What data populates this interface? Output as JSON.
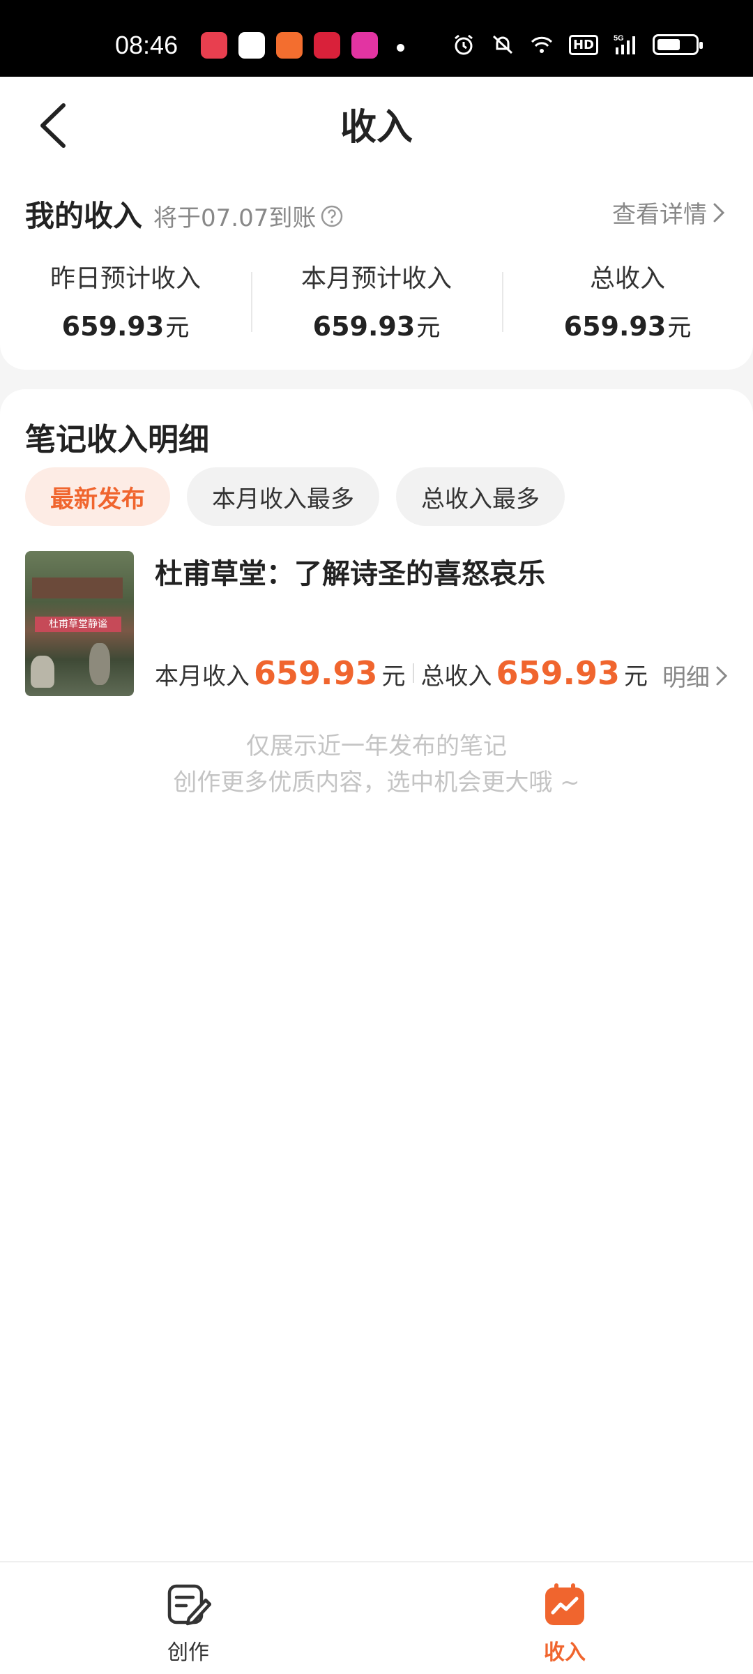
{
  "status_bar": {
    "time": "08:46",
    "apps": [
      "#e83f4f",
      "#ffffff",
      "#f36e2f",
      "#d9213a",
      "#e234a2"
    ],
    "hd": "HD",
    "net": "5G"
  },
  "header": {
    "title": "收入"
  },
  "earnings": {
    "title": "我的收入",
    "arrival_text": "将于07.07到账",
    "detail_link": "查看详情",
    "stats": [
      {
        "label": "昨日预计收入",
        "value": "659.93",
        "unit": "元"
      },
      {
        "label": "本月预计收入",
        "value": "659.93",
        "unit": "元"
      },
      {
        "label": "总收入",
        "value": "659.93",
        "unit": "元"
      }
    ]
  },
  "detail": {
    "title": "笔记收入明细",
    "filters": [
      "最新发布",
      "本月收入最多",
      "总收入最多"
    ],
    "active_filter": "最新发布",
    "notes": [
      {
        "thumb_text": "杜甫草堂静谧",
        "title": "杜甫草堂：了解诗圣的喜怒哀乐",
        "month_label": "本月收入",
        "month_value": "659.93",
        "total_label": "总收入",
        "total_value": "659.93",
        "unit": "元",
        "link": "明细"
      }
    ],
    "footnote_line1": "仅展示近一年发布的笔记",
    "footnote_line2": "创作更多优质内容，选中机会更大哦 ~"
  },
  "bottom_nav": {
    "items": [
      {
        "label": "创作",
        "icon": "edit-note-icon"
      },
      {
        "label": "收入",
        "icon": "income-chart-icon"
      }
    ],
    "active": "收入",
    "accent": "#f0652e"
  }
}
